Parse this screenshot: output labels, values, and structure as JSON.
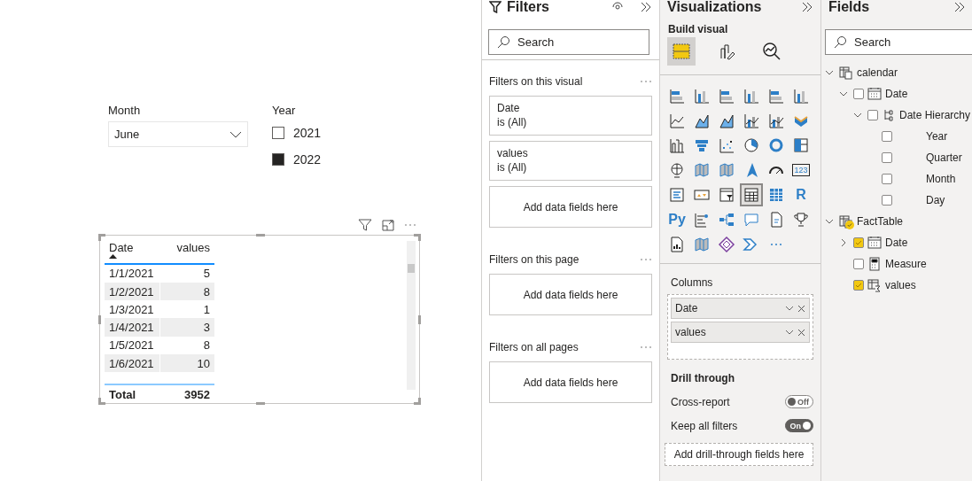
{
  "report": {
    "month_slicer": {
      "title": "Month",
      "value": "June"
    },
    "year_slicer": {
      "title": "Year",
      "options": [
        {
          "label": "2021",
          "checked": false
        },
        {
          "label": "2022",
          "checked": true
        }
      ]
    },
    "table_visual": {
      "columns": [
        {
          "label": "Date",
          "sorted": true
        },
        {
          "label": "values",
          "sorted": false
        }
      ],
      "rows": [
        [
          "1/1/2021",
          "5"
        ],
        [
          "1/2/2021",
          "8"
        ],
        [
          "1/3/2021",
          "1"
        ],
        [
          "1/4/2021",
          "3"
        ],
        [
          "1/5/2021",
          "8"
        ],
        [
          "1/6/2021",
          "10"
        ]
      ],
      "total": {
        "label": "Total",
        "value": "3952"
      }
    }
  },
  "filters_pane": {
    "title": "Filters",
    "search": {
      "placeholder": "Search"
    },
    "sections": [
      {
        "title": "Filters on this visual",
        "cards": [
          {
            "field": "Date",
            "condition": "is (All)"
          },
          {
            "field": "values",
            "condition": "is (All)"
          }
        ],
        "drop_zone": "Add data fields here"
      },
      {
        "title": "Filters on this page",
        "drop_zone": "Add data fields here"
      },
      {
        "title": "Filters on all pages",
        "drop_zone": "Add data fields here"
      }
    ]
  },
  "visualizations_pane": {
    "title": "Visualizations",
    "subtitle": "Build visual",
    "modes": [
      {
        "kind": "build",
        "selected": true
      },
      {
        "kind": "format",
        "selected": false
      },
      {
        "kind": "analytics",
        "selected": false
      }
    ],
    "gallery": [
      {
        "kind": "hbar",
        "selected": false
      },
      {
        "kind": "column",
        "selected": false
      },
      {
        "kind": "hbar",
        "selected": false
      },
      {
        "kind": "column",
        "selected": false
      },
      {
        "kind": "hbar",
        "selected": false
      },
      {
        "kind": "column",
        "selected": false
      },
      {
        "kind": "line",
        "selected": false
      },
      {
        "kind": "area",
        "selected": false
      },
      {
        "kind": "area",
        "selected": false
      },
      {
        "kind": "combo",
        "selected": false
      },
      {
        "kind": "combo",
        "selected": false
      },
      {
        "kind": "ribbon",
        "selected": false
      },
      {
        "kind": "waterfall",
        "selected": false
      },
      {
        "kind": "funnel",
        "selected": false
      },
      {
        "kind": "scatter",
        "selected": false
      },
      {
        "kind": "pie",
        "selected": false
      },
      {
        "kind": "donut",
        "selected": false
      },
      {
        "kind": "treemap",
        "selected": false
      },
      {
        "kind": "globe",
        "selected": false
      },
      {
        "kind": "map",
        "selected": false
      },
      {
        "kind": "map",
        "selected": false
      },
      {
        "kind": "pointer",
        "selected": false
      },
      {
        "kind": "gauge",
        "selected": false
      },
      {
        "kind": "card",
        "selected": false,
        "label": "123"
      },
      {
        "kind": "list",
        "selected": false
      },
      {
        "kind": "kpi",
        "selected": false
      },
      {
        "kind": "slicer",
        "selected": false
      },
      {
        "kind": "table",
        "selected": true
      },
      {
        "kind": "matrix",
        "selected": false
      },
      {
        "kind": "letter",
        "selected": false,
        "label": "R"
      },
      {
        "kind": "letter",
        "selected": false,
        "label": "Py"
      },
      {
        "kind": "influencers",
        "selected": false
      },
      {
        "kind": "tree",
        "selected": false
      },
      {
        "kind": "speech",
        "selected": false
      },
      {
        "kind": "document",
        "selected": false
      },
      {
        "kind": "trophy",
        "selected": false
      },
      {
        "kind": "report",
        "selected": false
      },
      {
        "kind": "map",
        "selected": false
      },
      {
        "kind": "diamond",
        "selected": false
      },
      {
        "kind": "chevrons",
        "selected": false
      },
      {
        "kind": "more",
        "selected": false
      }
    ],
    "wells": {
      "title": "Columns",
      "fields": [
        "Date",
        "values"
      ]
    },
    "drill_through": {
      "title": "Drill through",
      "toggles": [
        {
          "label": "Cross-report",
          "on": false,
          "state_text": "Off"
        },
        {
          "label": "Keep all filters",
          "on": true,
          "state_text": "On"
        }
      ],
      "drop_zone": "Add drill-through fields here"
    }
  },
  "fields_pane": {
    "title": "Fields",
    "search": {
      "placeholder": "Search"
    },
    "tree": [
      {
        "label": "calendar",
        "kind": "table",
        "checked": false,
        "expanded": true,
        "children": [
          {
            "label": "Date",
            "kind": "date",
            "checked": false,
            "expanded": true,
            "children": [
              {
                "label": "Date Hierarchy",
                "kind": "hierarchy",
                "checked": false,
                "expanded": true,
                "children": [
                  {
                    "label": "Year",
                    "kind": "level",
                    "checked": false
                  },
                  {
                    "label": "Quarter",
                    "kind": "level",
                    "checked": false
                  },
                  {
                    "label": "Month",
                    "kind": "level",
                    "checked": false
                  },
                  {
                    "label": "Day",
                    "kind": "level",
                    "checked": false
                  }
                ]
              }
            ]
          }
        ]
      },
      {
        "label": "FactTable",
        "kind": "table",
        "checked": true,
        "expanded": true,
        "children": [
          {
            "label": "Date",
            "kind": "date",
            "checked": true,
            "expanded": false
          },
          {
            "label": "Measure",
            "kind": "measure",
            "checked": false
          },
          {
            "label": "values",
            "kind": "column",
            "checked": true
          }
        ]
      }
    ]
  }
}
